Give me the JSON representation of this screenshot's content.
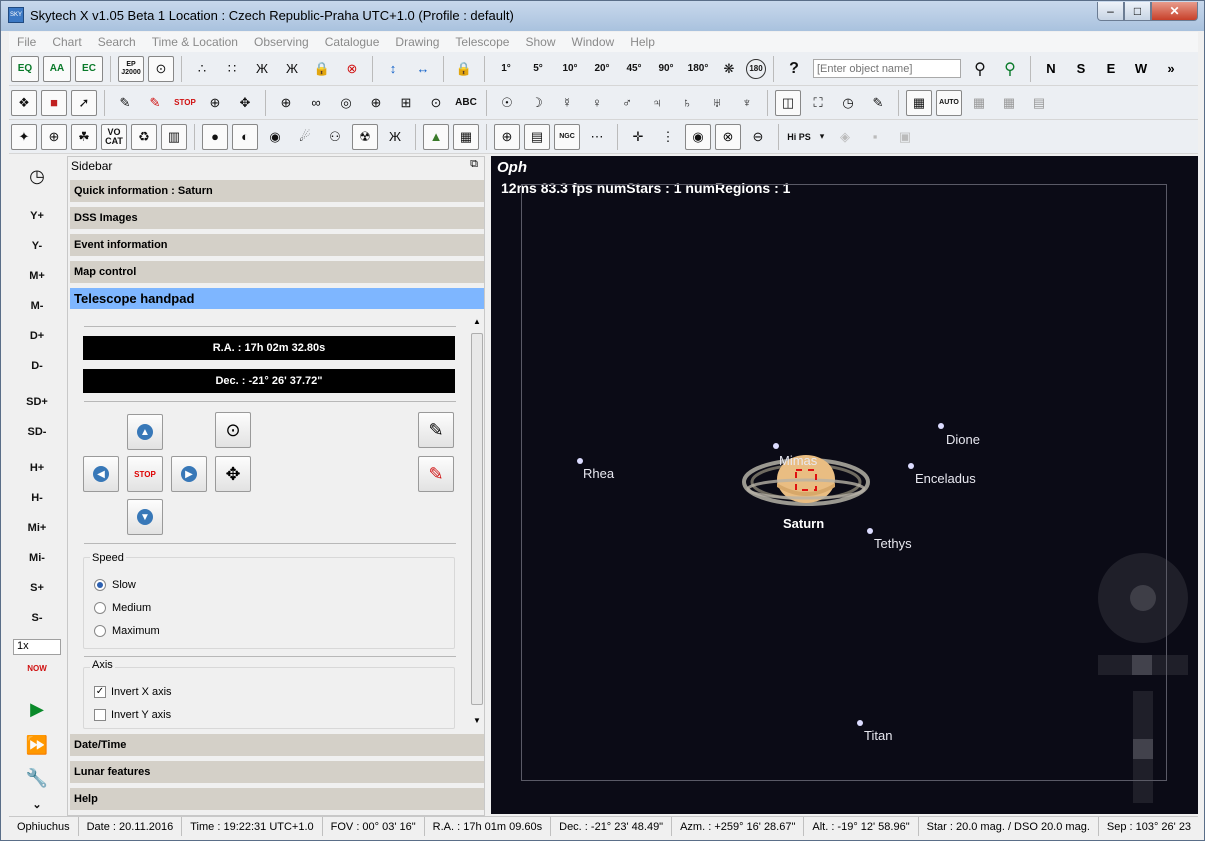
{
  "window": {
    "title": "Skytech X v1.05 Beta 1   Location : Czech Republic-Praha  UTC+1.0 (Profile : default)",
    "app_icon_text": "SKY"
  },
  "menu": [
    "File",
    "Chart",
    "Search",
    "Time & Location",
    "Observing",
    "Catalogue",
    "Drawing",
    "Telescope",
    "Show",
    "Window",
    "Help"
  ],
  "toolbar1": {
    "fov_labels": [
      "1°",
      "5°",
      "10°",
      "20°",
      "45°",
      "90°",
      "180°"
    ],
    "search_placeholder": "[Enter object name]",
    "directions": [
      "N",
      "S",
      "E",
      "W"
    ],
    "eq_label": "EQ",
    "aa_label": "AA",
    "ep_label": "EP J2000",
    "deg180_label": "180",
    "help_label": "?",
    "more_label": "»"
  },
  "toolbar2": {
    "stop_label": "STOP",
    "abc_label": "ABC",
    "auto_label": "AUTO"
  },
  "toolbar3": {
    "vo_label": "VO CAT",
    "ngc_label": "NGC",
    "hips_label": "Hi PS"
  },
  "leftbar": {
    "buttons": [
      "Y+",
      "Y-",
      "M+",
      "M-",
      "D+",
      "D-",
      "SD+",
      "SD-",
      "H+",
      "H-",
      "Mi+",
      "Mi-",
      "S+",
      "S-"
    ],
    "speed_value": "1x",
    "now_label": "NOW"
  },
  "sidebar": {
    "title": "Sidebar",
    "sections": [
      "Quick information : Saturn",
      "DSS Images",
      "Event information",
      "Map control",
      "Telescope handpad",
      "Date/Time",
      "Lunar features",
      "Help"
    ],
    "handpad": {
      "ra": "R.A. : 17h 02m 32.80s",
      "dec": "Dec. : -21° 26' 37.72\"",
      "stop": "STOP",
      "speed_label": "Speed",
      "speed_options": [
        "Slow",
        "Medium",
        "Maximum"
      ],
      "speed_selected": "Slow",
      "axis_label": "Axis",
      "invert_x": "Invert X axis",
      "invert_y": "Invert Y axis",
      "invert_x_checked": true,
      "invert_y_checked": false
    }
  },
  "sky": {
    "constellation": "Oph",
    "stats": "12ms 83.3 fps numStars : 1 numRegions : 1",
    "planet": "Saturn",
    "moons": [
      "Rhea",
      "Mimas",
      "Dione",
      "Enceladus",
      "Tethys",
      "Titan"
    ],
    "background_color": "#0b0b16"
  },
  "status": [
    "Ophiuchus",
    "Date : 20.11.2016",
    "Time : 19:22:31 UTC+1.0",
    "FOV : 00° 03' 16\"",
    "R.A. : 17h 01m 09.60s",
    "Dec. : -21° 23' 48.49\"",
    "Azm. : +259° 16' 28.67\"",
    "Alt. : -19° 12' 58.96\"",
    "Star : 20.0 mag. / DSO 20.0 mag.",
    "Sep : 103° 26' 23"
  ]
}
